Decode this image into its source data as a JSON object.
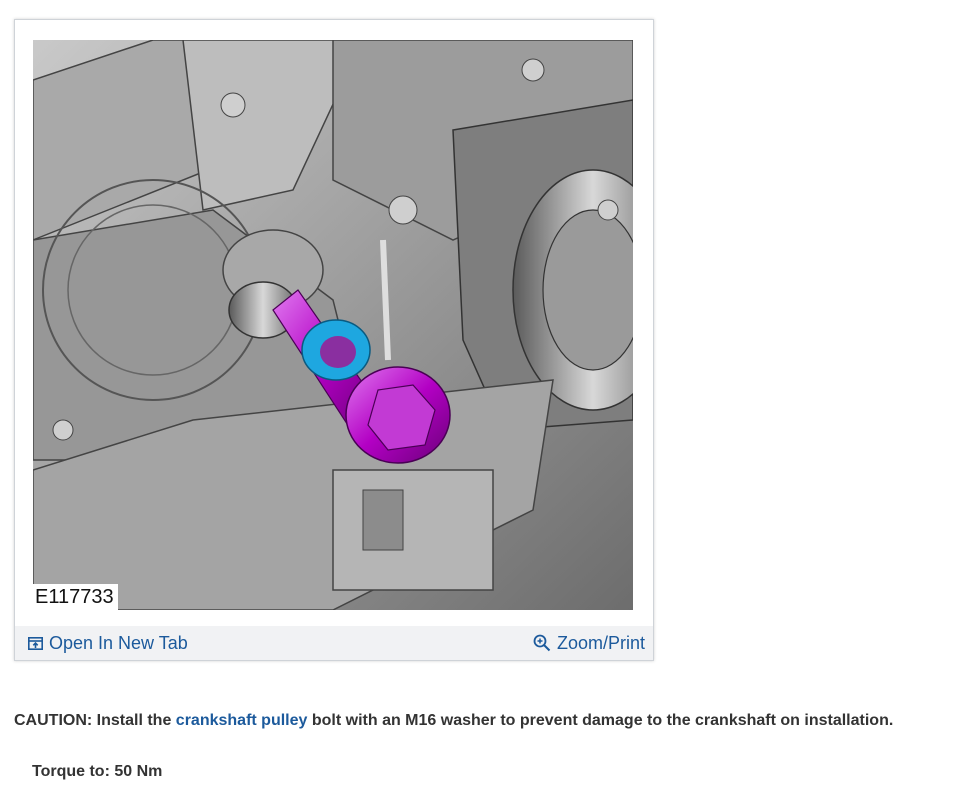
{
  "figure": {
    "id_label": "E117733",
    "open_tab_label": "Open In New Tab",
    "zoom_label": "Zoom/Print",
    "colors": {
      "bolt": "#b300c4",
      "washer": "#1ea7e0",
      "metal": "#8f8f8f"
    },
    "icons": {
      "open_tab": "open-new-tab-icon",
      "zoom": "zoom-in-icon"
    }
  },
  "caution": {
    "prefix": "CAUTION: Install the",
    "link": "crankshaft pulley",
    "suffix": "bolt with an M16 washer to prevent damage to the crankshaft on installation."
  },
  "torque": {
    "label": "Torque to:",
    "value": "50 Nm"
  }
}
